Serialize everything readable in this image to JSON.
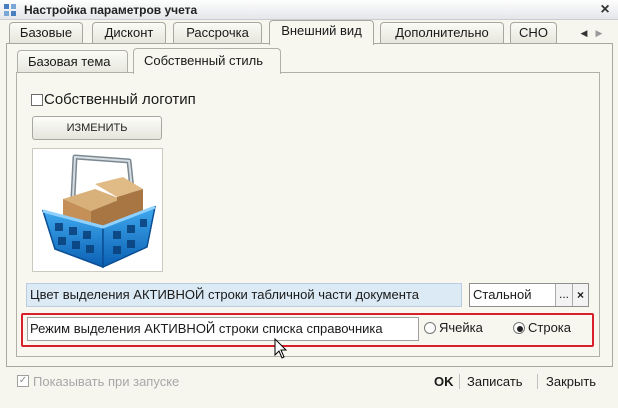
{
  "window": {
    "title": "Настройка параметров учета",
    "close_symbol": "×"
  },
  "tabs": [
    "Базовые",
    "Дисконт",
    "Рассрочка",
    "Внешний вид",
    "Дополнительно",
    "СНО"
  ],
  "active_tab": "Внешний вид",
  "tab_scroll": {
    "left": "◀",
    "right": "▶"
  },
  "subtabs": [
    "Базовая тема",
    "Собственный стиль"
  ],
  "active_subtab": "Собственный стиль",
  "own_logo": {
    "label": "Собственный логотип",
    "checked": false
  },
  "change_button": "ИЗМЕНИТЬ",
  "logo_image": "shopping-basket-icon",
  "active_row_color": {
    "label": "Цвет выделения АКТИВНОЙ строки табличной части документа",
    "value": "Стальной",
    "select_symbol": "...",
    "clear_symbol": "×"
  },
  "active_row_mode": {
    "label": "Режим выделения АКТИВНОЙ строки списка справочника",
    "options": [
      "Ячейка",
      "Строка"
    ],
    "selected": "Строка"
  },
  "show_on_start": {
    "label": "Показывать при запуске",
    "checked": true,
    "disabled": true
  },
  "footer": {
    "ok": "OK",
    "save": "Записать",
    "close": "Закрыть"
  },
  "colors": {
    "highlight_frame": "#d8202a",
    "label_bg": "#dbeaf4",
    "panel_bg": "#f7f7f0"
  }
}
